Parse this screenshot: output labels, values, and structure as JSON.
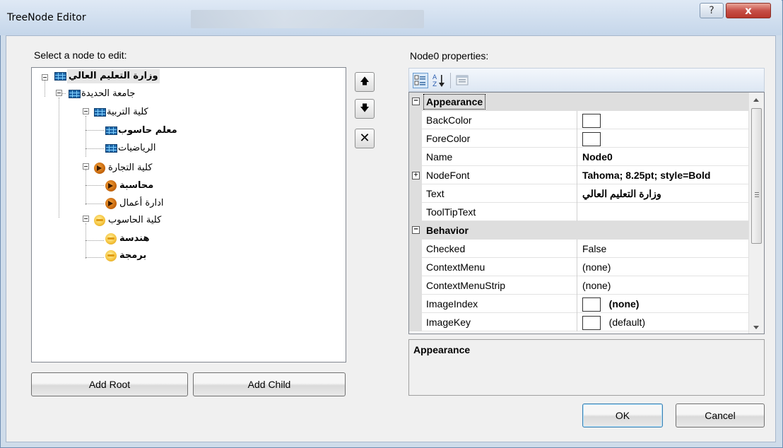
{
  "window": {
    "title": "TreeNode Editor",
    "help_glyph": "?",
    "close_glyph": "x"
  },
  "tree_section": {
    "label": "Select a node to edit:",
    "nodes": [
      {
        "label": "وزارة التعليم العالي",
        "icon": "table-icon",
        "selected": true
      },
      {
        "label": "جامعة الحديدة",
        "icon": "table-icon"
      },
      {
        "label": "كلية التربية",
        "icon": "table-icon"
      },
      {
        "label": "معلم حاسوب",
        "icon": "table-icon"
      },
      {
        "label": "الرياضيات",
        "icon": "table-icon"
      },
      {
        "label": "كلية التجارة",
        "icon": "orange-play-icon"
      },
      {
        "label": "محاسبة",
        "icon": "orange-play-icon"
      },
      {
        "label": "ادارة أعمال",
        "icon": "orange-play-icon"
      },
      {
        "label": "كلية الحاسوب",
        "icon": "yellow-face-icon"
      },
      {
        "label": "هندسة",
        "icon": "yellow-face-icon"
      },
      {
        "label": "برمجة",
        "icon": "yellow-face-icon"
      }
    ],
    "add_root": "Add Root",
    "add_child": "Add Child"
  },
  "side_buttons": {
    "up_glyph": "🡅",
    "down_glyph": "🡇",
    "delete_glyph": "✕"
  },
  "properties": {
    "label": "Node0 properties:",
    "categories": {
      "appearance": "Appearance",
      "behavior": "Behavior"
    },
    "rows": {
      "backcolor": {
        "name": "BackColor",
        "value": ""
      },
      "forecolor": {
        "name": "ForeColor",
        "value": ""
      },
      "name": {
        "name": "Name",
        "value": "Node0"
      },
      "nodefont": {
        "name": "NodeFont",
        "value": "Tahoma; 8.25pt; style=Bold"
      },
      "text": {
        "name": "Text",
        "value": "وزارة التعليم العالي"
      },
      "tooltiptext": {
        "name": "ToolTipText",
        "value": ""
      },
      "checked": {
        "name": "Checked",
        "value": "False"
      },
      "contextmenu": {
        "name": "ContextMenu",
        "value": "(none)"
      },
      "contextmenustrip": {
        "name": "ContextMenuStrip",
        "value": "(none)"
      },
      "imageindex": {
        "name": "ImageIndex",
        "value": "(none)"
      },
      "imagekey": {
        "name": "ImageKey",
        "value": "(default)"
      }
    },
    "description_title": "Appearance"
  },
  "footer": {
    "ok": "OK",
    "cancel": "Cancel"
  }
}
